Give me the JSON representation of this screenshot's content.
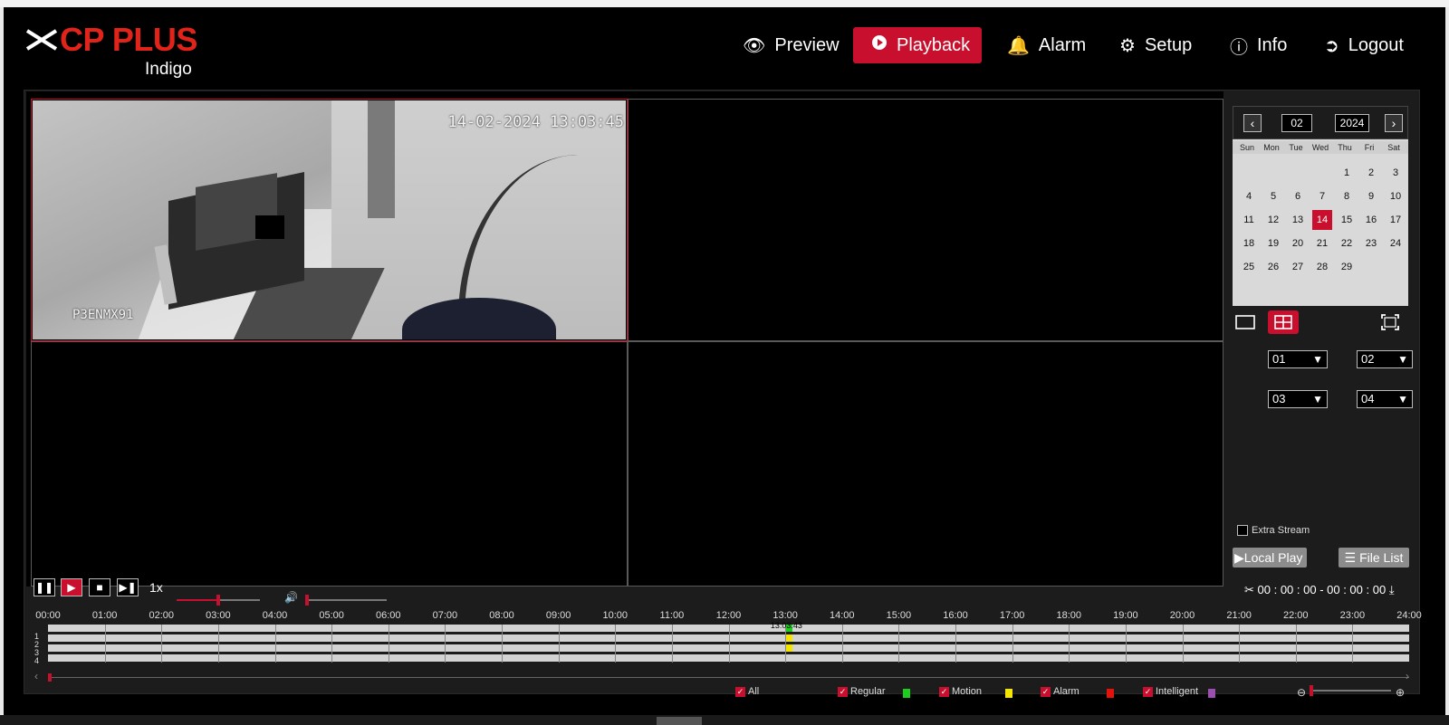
{
  "brand": {
    "name": "CP PLUS",
    "sub": "Indigo"
  },
  "nav": {
    "preview": "Preview",
    "playback": "Playback",
    "alarm": "Alarm",
    "setup": "Setup",
    "info": "Info",
    "logout": "Logout"
  },
  "video": {
    "timestamp": "14-02-2024 13:03:45",
    "camera_name": "P3ENMX91"
  },
  "calendar": {
    "month": "02",
    "year": "2024",
    "weekdays": [
      "Sun",
      "Mon",
      "Tue",
      "Wed",
      "Thu",
      "Fri",
      "Sat"
    ],
    "days": [
      "1",
      "2",
      "3",
      "4",
      "5",
      "6",
      "7",
      "8",
      "9",
      "10",
      "11",
      "12",
      "13",
      "14",
      "15",
      "16",
      "17",
      "18",
      "19",
      "20",
      "21",
      "22",
      "23",
      "24",
      "25",
      "26",
      "27",
      "28",
      "29"
    ],
    "first_weekday_index": 4,
    "selected_day": "14"
  },
  "channels": {
    "ch1": "01",
    "ch2": "02",
    "ch3": "03",
    "ch4": "04"
  },
  "extra_stream": "Extra Stream",
  "buttons": {
    "local_play": "Local Play",
    "file_list": "File List"
  },
  "playback": {
    "speed": "1x",
    "clip_range": "00 : 00 : 00 - 00 : 00 : 00",
    "speed_level": 0.5,
    "volume_level": 0.0
  },
  "timeline": {
    "hours": [
      "00:00",
      "01:00",
      "02:00",
      "03:00",
      "04:00",
      "05:00",
      "06:00",
      "07:00",
      "08:00",
      "09:00",
      "10:00",
      "11:00",
      "12:00",
      "13:00",
      "14:00",
      "15:00",
      "16:00",
      "17:00",
      "18:00",
      "19:00",
      "20:00",
      "21:00",
      "22:00",
      "23:00",
      "24:00"
    ],
    "rows": [
      "1",
      "2",
      "3",
      "4"
    ],
    "cursor_time": "13:03:43",
    "cursor_hour": 13.06
  },
  "legend": {
    "all": "All",
    "regular": "Regular",
    "motion": "Motion",
    "alarm": "Alarm",
    "intelligent": "Intelligent",
    "colors": {
      "regular": "#1ccf1c",
      "motion": "#f5e600",
      "alarm": "#e3120b",
      "intelligent": "#9b4fae"
    }
  },
  "colors": {
    "accent": "#c8102e"
  }
}
